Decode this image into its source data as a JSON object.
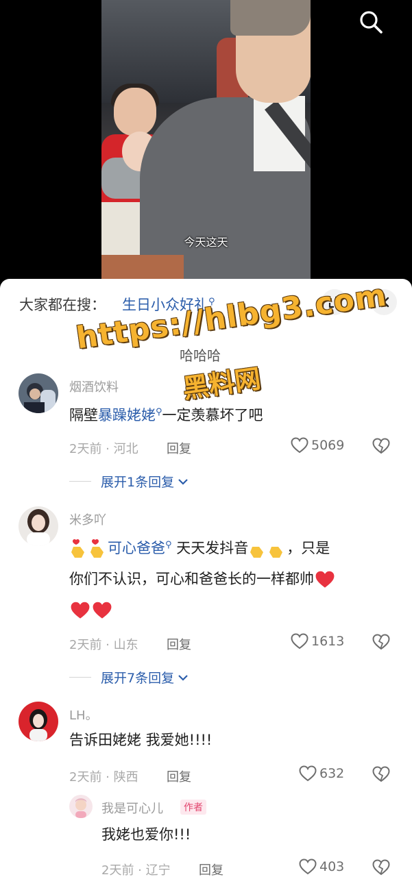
{
  "video": {
    "subtitle": "今天这天"
  },
  "sheet": {
    "search_prompt": "大家都在搜：",
    "search_term": "生日小众好礼"
  },
  "watermark": {
    "line1": "https://hlbg3.com",
    "line2": "黑料网"
  },
  "partial_comment": "哈哈哈",
  "comments": [
    {
      "username": "烟酒饮料",
      "text_prefix": "隔壁",
      "link": "暴躁姥姥",
      "text_suffix": "一定羡慕坏了吧",
      "time": "2天前 · 河北",
      "reply_label": "回复",
      "likes": "5069",
      "expand": "展开1条回复"
    },
    {
      "username": "米多吖",
      "link": "可心爸爸",
      "text_mid": "天天发抖音",
      "text_end": "，只是",
      "line2": "你们不认识，可心和爸爸长的一样都帅",
      "time": "2天前 · 山东",
      "reply_label": "回复",
      "likes": "1613",
      "expand": "展开7条回复"
    },
    {
      "username": "LH。",
      "text": "告诉田姥姥  我爱她!!!!",
      "time": "2天前 · 陕西",
      "reply_label": "回复",
      "likes": "632"
    }
  ],
  "reply": {
    "username": "我是可心儿",
    "badge": "作者",
    "text": "我姥也爱你!!!",
    "time": "2天前 · 辽宁",
    "reply_label": "回复",
    "likes": "403"
  },
  "colors": {
    "link": "#2b5dab",
    "watermark": "#f6b330",
    "heart": "#e8323f"
  }
}
